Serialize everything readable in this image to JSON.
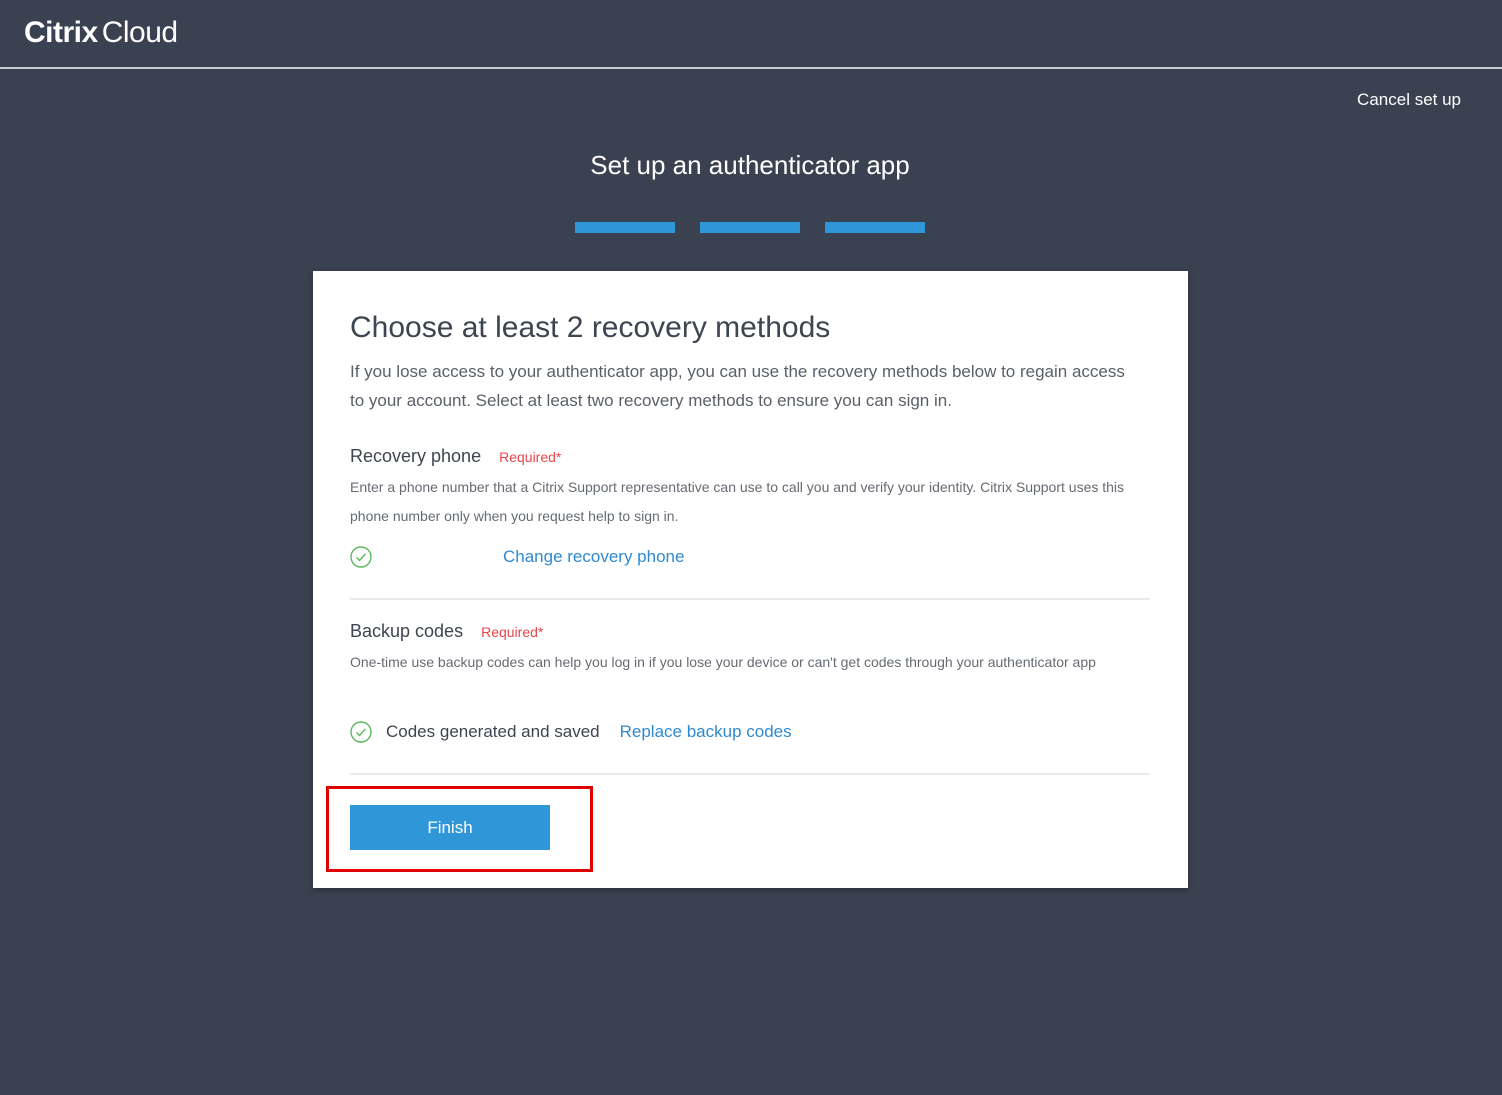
{
  "header": {
    "brand": "Citrix",
    "product": "Cloud"
  },
  "cancel_label": "Cancel set up",
  "page_heading": "Set up an authenticator app",
  "progress": {
    "total_steps": 3,
    "completed_steps": 3,
    "color": "#2f96d8"
  },
  "card": {
    "title": "Choose at least 2 recovery methods",
    "description": "If you lose access to your authenticator app, you can use the recovery methods below to regain access to your account. Select at least two recovery methods to ensure you can sign in.",
    "recovery_phone": {
      "label": "Recovery phone",
      "required": "Required*",
      "description": "Enter a phone number that a Citrix Support representative can use to call you and verify your identity. Citrix Support uses this phone number only when you request help to sign in.",
      "status_icon": "check-circle-icon",
      "link": "Change recovery phone"
    },
    "backup_codes": {
      "label": "Backup codes",
      "required": "Required*",
      "description": "One-time use backup codes can help you log in if you lose your device or can't get codes through your authenticator app",
      "status_icon": "check-circle-icon",
      "status_text": "Codes generated and saved",
      "link": "Replace backup codes"
    },
    "finish_label": "Finish"
  },
  "colors": {
    "background": "#3a4150",
    "accent": "#2f96d8",
    "required": "#e8464a",
    "check": "#5cb85c",
    "highlight": "#e00000"
  }
}
